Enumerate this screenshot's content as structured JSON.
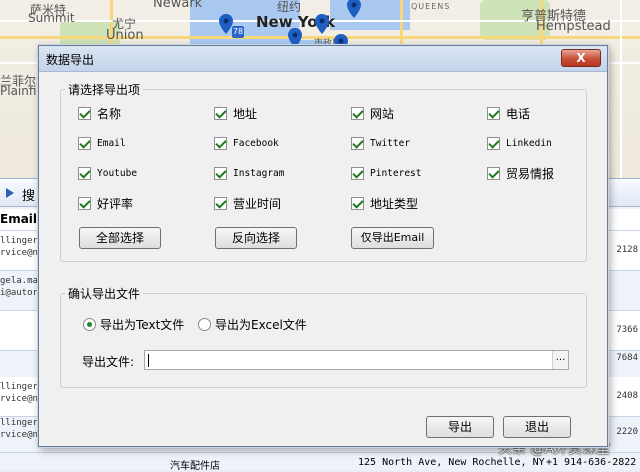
{
  "map": {
    "labels": {
      "summit_cn": "萨米特",
      "summit": "Summit",
      "union_cn": "尤宁",
      "union": "Union",
      "newark": "Newark",
      "newyork": "New York",
      "newyork_cn": "纽约",
      "queens": "QUEENS",
      "hempstead_cn": "亨普斯特德",
      "hempstead": "Hempstead",
      "plainfield_cn": "兰菲尔尔",
      "plainfield": "Plainfield",
      "ny_short": "市政厅",
      "route": "78",
      "route2": "278"
    }
  },
  "background": {
    "toolbar_label": "搜",
    "column_header": "Email",
    "rows": [
      {
        "email1": "llinger@",
        "email2": "rvice@n",
        "num": "2128"
      },
      {
        "email1": "gela.ma",
        "email2": "i@autor",
        "num": ""
      },
      {
        "email1": "",
        "email2": "",
        "num": "7366"
      },
      {
        "email1": "",
        "email2": "",
        "num": "7684"
      },
      {
        "email1": "llinger@",
        "email2": "rvice@n",
        "num": "2408"
      },
      {
        "email1": "llinger@",
        "email2": "rvice@n",
        "num": "2220"
      }
    ],
    "bottom_name": "汽车配件店",
    "bottom_address": "125 North Ave, New Rochelle, NY",
    "bottom_phone": "+1 914-636-2822"
  },
  "watermark": "头条 @A外贸课堂",
  "dialog": {
    "title": "数据导出",
    "close_label": "X",
    "group1_title": "请选择导出项",
    "options": [
      {
        "label": "名称",
        "checked": true
      },
      {
        "label": "地址",
        "checked": true
      },
      {
        "label": "网站",
        "checked": true
      },
      {
        "label": "电话",
        "checked": true
      },
      {
        "label": "Email",
        "checked": true
      },
      {
        "label": "Facebook",
        "checked": true
      },
      {
        "label": "Twitter",
        "checked": true
      },
      {
        "label": "Linkedin",
        "checked": true
      },
      {
        "label": "Youtube",
        "checked": true
      },
      {
        "label": "Instagram",
        "checked": true
      },
      {
        "label": "Pinterest",
        "checked": true
      },
      {
        "label": "贸易情报",
        "checked": true
      },
      {
        "label": "好评率",
        "checked": true
      },
      {
        "label": "营业时间",
        "checked": true
      },
      {
        "label": "地址类型",
        "checked": true
      }
    ],
    "buttons": {
      "select_all": "全部选择",
      "invert": "反向选择",
      "email_only": "仅导出Email"
    },
    "group2_title": "确认导出文件",
    "radio_text": "导出为Text文件",
    "radio_excel": "导出为Excel文件",
    "file_label": "导出文件:",
    "file_value": "",
    "browse_label": "...",
    "export_button": "导出",
    "exit_button": "退出"
  }
}
